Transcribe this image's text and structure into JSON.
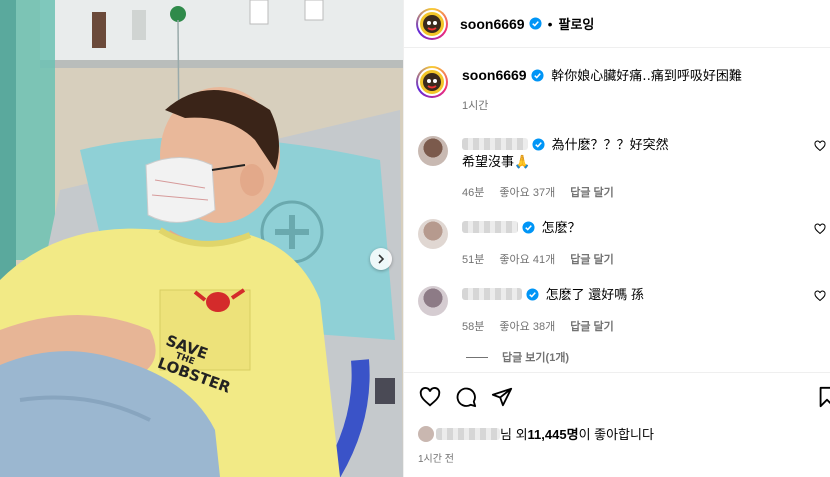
{
  "post": {
    "username": "soon6669",
    "follow_label": "팔로잉",
    "dot": "•",
    "caption": "幹你娘心臟好痛‥痛到呼吸好困難",
    "caption_time": "1시간",
    "photo_shirt_text": [
      "SAVE",
      "THE",
      "LOBSTER"
    ]
  },
  "comments": [
    {
      "text_line1": "為什麽？？？好突然",
      "text_line2": "希望沒事🙏",
      "time": "46분",
      "likes": "좋아요 37개",
      "reply": "답글 달기",
      "verified": true
    },
    {
      "text_line1": "怎麽？",
      "text_line2": "",
      "time": "51분",
      "likes": "좋아요 41개",
      "reply": "답글 달기",
      "verified": true
    },
    {
      "text_line1": "怎麽了 還好嗎 孫",
      "text_line2": "",
      "time": "58분",
      "likes": "좋아요 38개",
      "reply": "답글 달기",
      "verified": true
    }
  ],
  "view_replies": "답글 보기(1개)",
  "likes_summary": {
    "suffix": "님 외 ",
    "count": "11,445명",
    "tail": "이 좋아합니다"
  },
  "post_time": "1시간 전",
  "icons": [
    "heart-icon",
    "comment-icon",
    "share-icon",
    "bookmark-icon",
    "chevron-right-icon",
    "verified-badge-icon"
  ],
  "colors": {
    "verified": "#0095f6",
    "meta": "#737373",
    "shirt": "#f2ea86",
    "pillow": "#8fd0d6"
  }
}
